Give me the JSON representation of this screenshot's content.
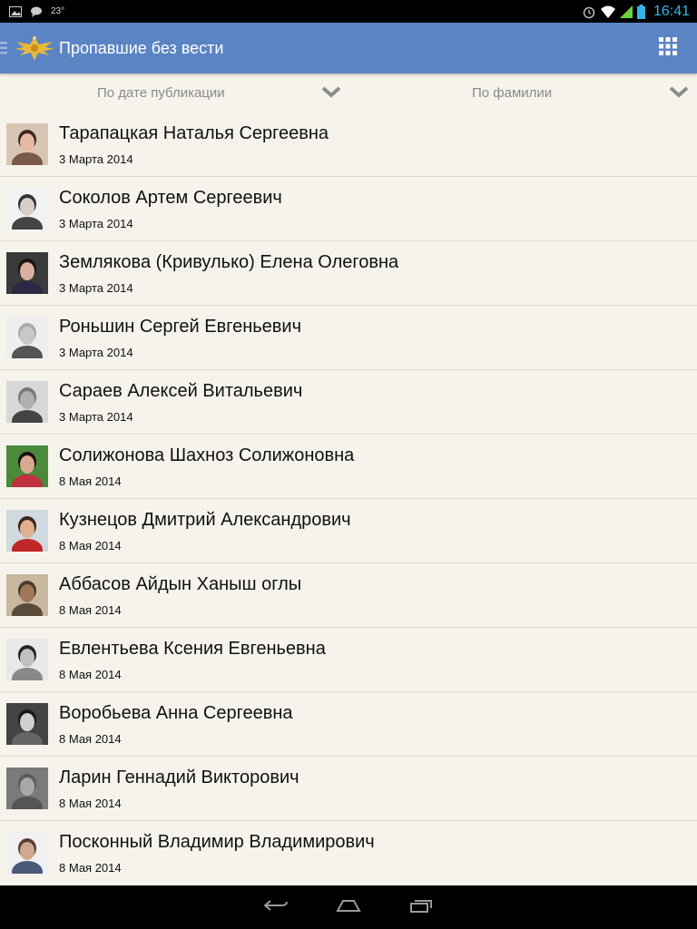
{
  "status_bar": {
    "temperature": "23°",
    "time": "16:41",
    "icons": [
      "image-icon",
      "chat-icon",
      "alarm-icon",
      "wifi-icon",
      "signal-icon",
      "battery-icon"
    ]
  },
  "header": {
    "title": "Пропавшие без вести",
    "logo": "eagle-emblem-icon",
    "menu_icon": "grid-menu-icon"
  },
  "filters": {
    "date_label": "По дате публикации",
    "name_label": "По фамилии"
  },
  "people": [
    {
      "name": "Тарапацкая Наталья Сергеевна",
      "date": "3 Марта 2014"
    },
    {
      "name": "Соколов Артем Сергеевич",
      "date": "3 Марта 2014"
    },
    {
      "name": "Землякова (Кривулько) Елена Олеговна",
      "date": "3 Марта 2014"
    },
    {
      "name": "Роньшин Сергей Евгеньевич",
      "date": "3 Марта 2014"
    },
    {
      "name": "Сараев Алексей Витальевич",
      "date": "3 Марта 2014"
    },
    {
      "name": "Солижонова Шахноз Солижоновна",
      "date": "8 Мая 2014"
    },
    {
      "name": "Кузнецов Дмитрий Александрович",
      "date": "8 Мая 2014"
    },
    {
      "name": "Аббасов Айдын Ханыш оглы",
      "date": "8 Мая 2014"
    },
    {
      "name": "Евлентьева Ксения Евгеньевна",
      "date": "8 Мая 2014"
    },
    {
      "name": "Воробьева Анна Сергеевна",
      "date": "8 Мая 2014"
    },
    {
      "name": "Ларин Геннадий Викторович",
      "date": "8 Мая 2014"
    },
    {
      "name": "Посконный Владимир Владимирович",
      "date": "8 Мая 2014"
    }
  ],
  "colors": {
    "action_bar": "#5b84c4",
    "background": "#f6f3ec",
    "clock": "#35b5e5"
  }
}
